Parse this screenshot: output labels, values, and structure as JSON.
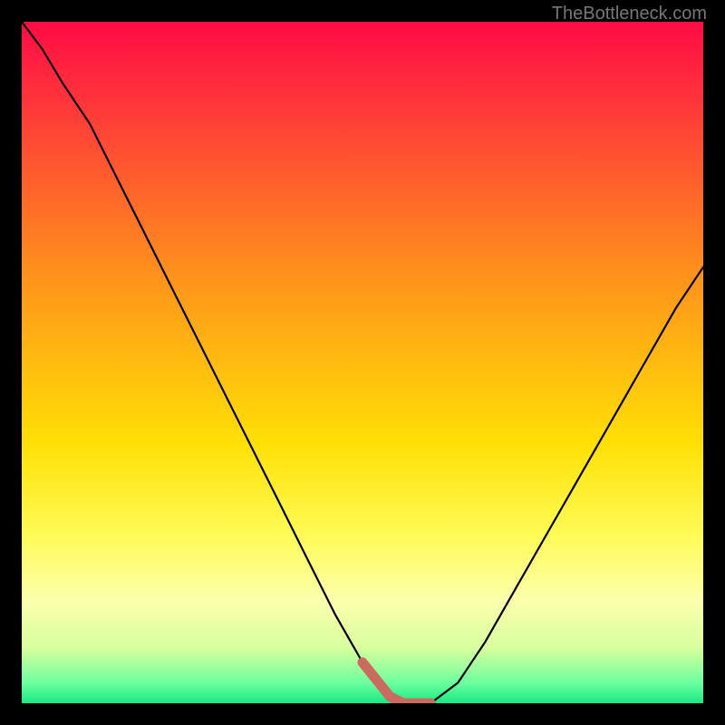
{
  "watermark": "TheBottleneck.com",
  "colors": {
    "background": "#000000",
    "curve_stroke": "#000000",
    "highlight_stroke": "#cc6a5f",
    "gradient_top": "#ff0b45",
    "gradient_bottom": "#18e884"
  },
  "chart_data": {
    "type": "line",
    "title": "",
    "xlabel": "",
    "ylabel": "",
    "xlim": [
      0,
      100
    ],
    "ylim": [
      0,
      100
    ],
    "x": [
      0,
      3,
      6,
      10,
      14,
      18,
      22,
      26,
      30,
      34,
      38,
      42,
      46,
      50,
      54,
      56,
      60,
      64,
      68,
      72,
      76,
      80,
      84,
      88,
      92,
      96,
      100
    ],
    "values": [
      100,
      96,
      91,
      85,
      77,
      69,
      61,
      53,
      45,
      37,
      29,
      21,
      13,
      6,
      1,
      0,
      0,
      3,
      9,
      16,
      23,
      30,
      37,
      44,
      51,
      58,
      64
    ],
    "highlight_range_x": [
      50,
      63
    ],
    "note": "Values read from pixel positions of the V-shaped bottleneck curve over a normalized 0-100 x/y domain; y=0 is the green bottom band, y=100 is the top red edge. The bottom of the V (optimal region) is highlighted."
  }
}
